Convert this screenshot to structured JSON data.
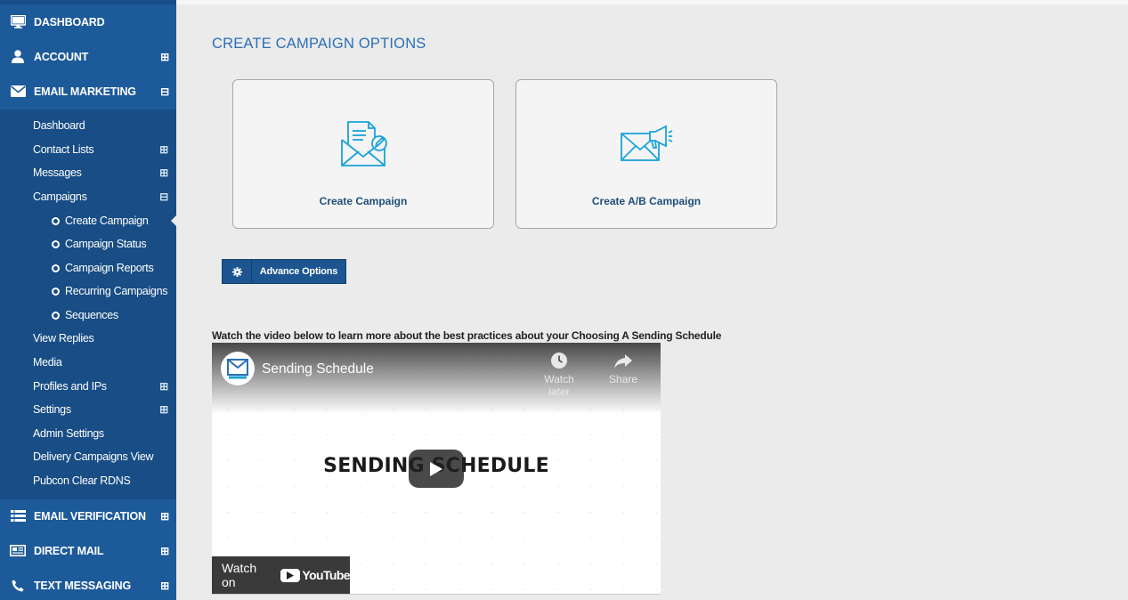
{
  "sidebar": {
    "items": {
      "dashboard": "DASHBOARD",
      "account": "ACCOUNT",
      "email_marketing": "EMAIL MARKETING",
      "email_verification": "EMAIL VERIFICATION",
      "direct_mail": "DIRECT MAIL",
      "text_messaging": "TEXT MESSAGING"
    },
    "email_marketing_sub": {
      "dashboard": "Dashboard",
      "contact_lists": "Contact Lists",
      "messages": "Messages",
      "campaigns": "Campaigns",
      "view_replies": "View Replies",
      "media": "Media",
      "profiles_ips": "Profiles and IPs",
      "settings": "Settings",
      "admin_settings": "Admin Settings",
      "delivery_campaigns_view": "Delivery Campaigns View",
      "pubcon_clear_rdns": "Pubcon Clear RDNS"
    },
    "campaigns_sub": {
      "create_campaign": "Create Campaign",
      "campaign_status": "Campaign Status",
      "campaign_reports": "Campaign Reports",
      "recurring_campaigns": "Recurring Campaigns",
      "sequences": "Sequences"
    },
    "expand_symbol": "⊞",
    "collapse_symbol": "⊟"
  },
  "main": {
    "title": "CREATE CAMPAIGN OPTIONS",
    "cards": {
      "create_campaign": "Create Campaign",
      "create_ab_campaign": "Create A/B Campaign"
    },
    "advance_options": "Advance Options",
    "video_caption": "Watch the video below to learn more about the best practices about your Choosing A Sending Schedule"
  },
  "video": {
    "title": "Sending Schedule",
    "watch_later": "Watch later",
    "share": "Share",
    "heading": "SENDING SCHEDULE",
    "watch_on": "Watch on",
    "brand": "YouTube"
  },
  "colors": {
    "sidebar": "#1d5a9a",
    "submenu": "#184d85",
    "accent": "#2c6fb7",
    "icon": "#1aa3d9"
  }
}
